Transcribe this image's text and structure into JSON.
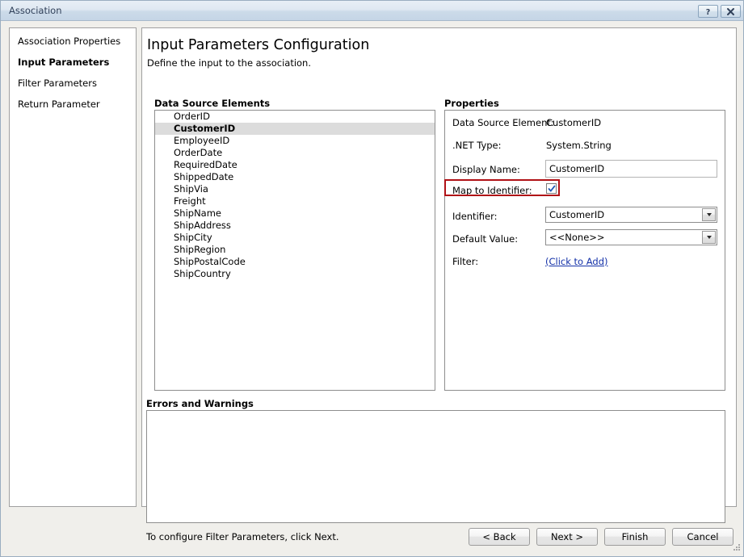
{
  "window": {
    "title": "Association",
    "help_button": "?",
    "close_button": "x"
  },
  "sidebar": {
    "items": [
      {
        "label": "Association Properties",
        "current": false
      },
      {
        "label": "Input Parameters",
        "current": true
      },
      {
        "label": "Filter Parameters",
        "current": false
      },
      {
        "label": "Return Parameter",
        "current": false
      }
    ]
  },
  "main": {
    "title": "Input Parameters Configuration",
    "subtitle": "Define the input to the association.",
    "data_source_elements": {
      "label": "Data Source Elements",
      "items": [
        "OrderID",
        "CustomerID",
        "EmployeeID",
        "OrderDate",
        "RequiredDate",
        "ShippedDate",
        "ShipVia",
        "Freight",
        "ShipName",
        "ShipAddress",
        "ShipCity",
        "ShipRegion",
        "ShipPostalCode",
        "ShipCountry"
      ],
      "selected": "CustomerID"
    },
    "properties": {
      "label": "Properties",
      "data_source_element_label": "Data Source Element:",
      "data_source_element_value": "CustomerID",
      "net_type_label": ".NET Type:",
      "net_type_value": "System.String",
      "display_name_label": "Display Name:",
      "display_name_value": "CustomerID",
      "map_to_identifier_label": "Map to Identifier:",
      "map_to_identifier_checked": true,
      "identifier_label": "Identifier:",
      "identifier_value": "CustomerID",
      "default_value_label": "Default Value:",
      "default_value_value": "<<None>>",
      "filter_label": "Filter:",
      "filter_link": "(Click to Add)"
    },
    "errors_and_warnings": {
      "label": "Errors and Warnings",
      "content": ""
    },
    "status": "To configure Filter Parameters, click Next."
  },
  "footer": {
    "back": "< Back",
    "next": "Next >",
    "finish": "Finish",
    "cancel": "Cancel"
  },
  "colors": {
    "highlight_border": "#b01116",
    "link": "#1431a8",
    "selection_bg": "#dcdcdc",
    "titlebar": "#ccdbe9"
  }
}
